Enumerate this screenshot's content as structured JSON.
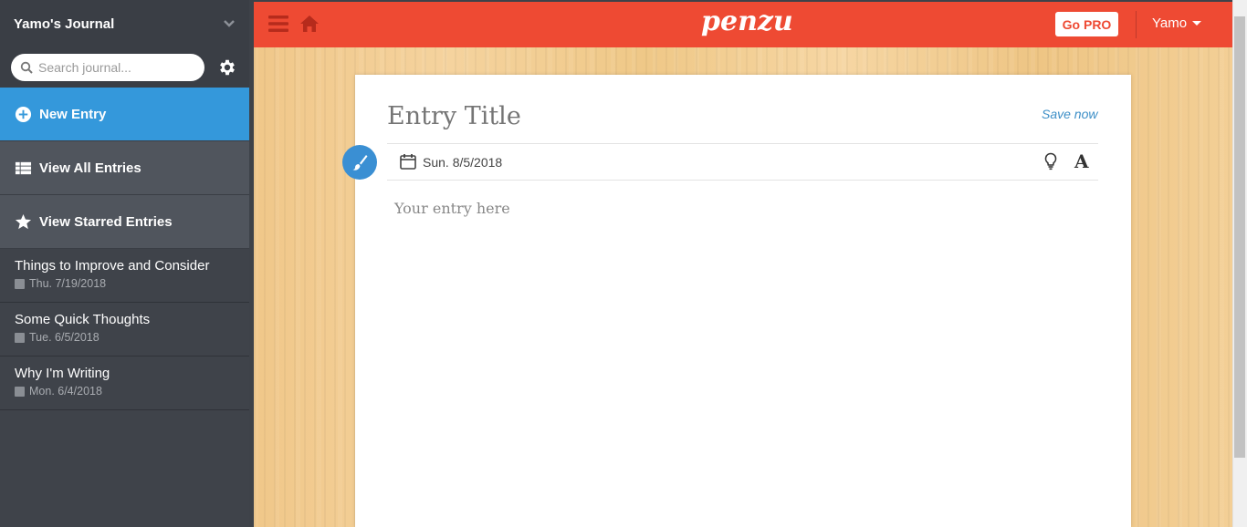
{
  "sidebar": {
    "journal_title": "Yamo's Journal",
    "search_placeholder": "Search journal...",
    "nav": [
      {
        "label": "New Entry",
        "icon": "plus-circle-icon"
      },
      {
        "label": "View All Entries",
        "icon": "grid-list-icon"
      },
      {
        "label": "View Starred Entries",
        "icon": "star-icon"
      }
    ],
    "entries": [
      {
        "title": "Things to Improve and Consider",
        "date": "Thu. 7/19/2018"
      },
      {
        "title": "Some Quick Thoughts",
        "date": "Tue. 6/5/2018"
      },
      {
        "title": "Why I'm Writing",
        "date": "Mon. 6/4/2018"
      }
    ]
  },
  "topbar": {
    "logo": "penzu",
    "go_pro": "Go PRO",
    "user": "Yamo"
  },
  "editor": {
    "title_placeholder": "Entry Title",
    "save_now": "Save now",
    "date": "Sun. 8/5/2018",
    "body_placeholder": "Your entry here"
  },
  "colors": {
    "accent_red": "#ee4a33",
    "accent_blue": "#3498db",
    "sidebar_bg": "#3f434a"
  }
}
